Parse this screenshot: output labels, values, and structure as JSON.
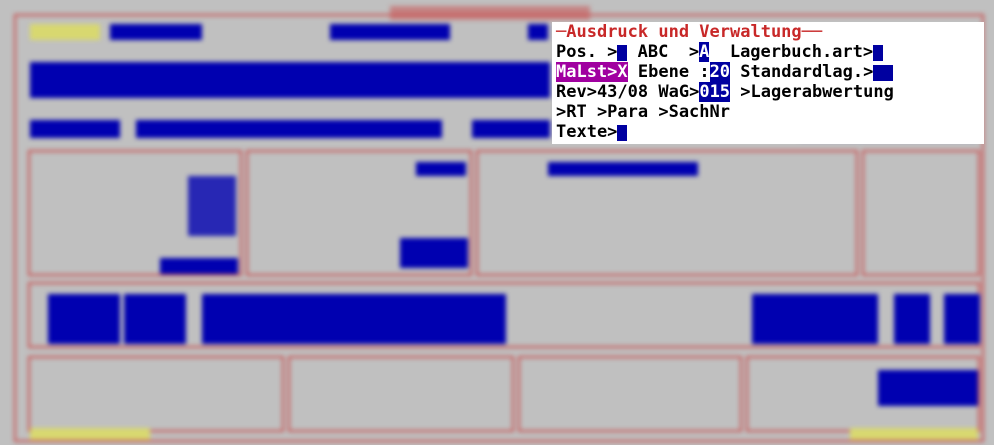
{
  "colors": {
    "background": "#c0c0c0",
    "frame": "#c85050",
    "field": "#0000b0",
    "popup_bg": "#ffffff",
    "popup_title": "#c82828",
    "highlight": "#a000a0"
  },
  "popup": {
    "title": "Ausdruck und Verwaltung",
    "rows": [
      {
        "left": "Pos. >",
        "mid": "ABC  >",
        "mid_value": "A",
        "right": "Lagerbuch.art>"
      },
      {
        "left": "MaLst>X",
        "mid": "Ebene :",
        "mid_value": "20",
        "right": "Standardlag.>"
      },
      {
        "left": "Rev>43/08",
        "mid": "WaG>",
        "mid_value": "015",
        "right": ">Lagerabwertung"
      },
      {
        "left": ">RT >Para >SachNr"
      },
      {
        "left": "Texte>"
      }
    ]
  }
}
